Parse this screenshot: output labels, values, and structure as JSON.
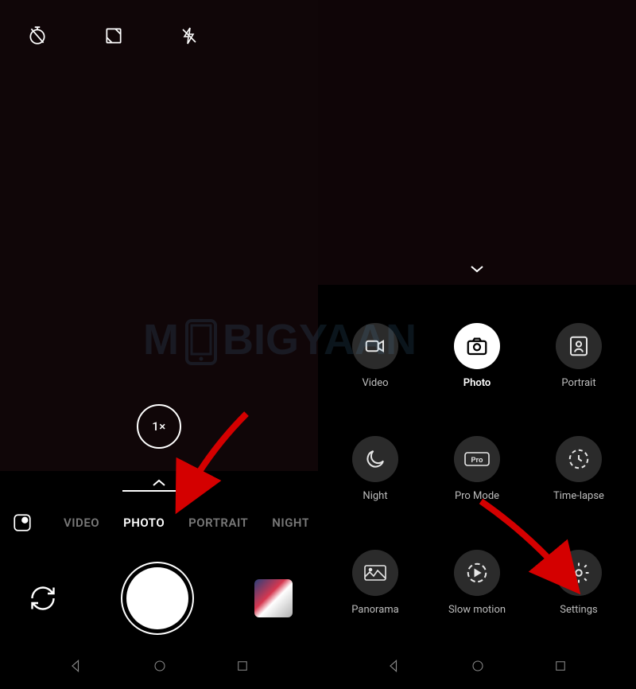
{
  "left": {
    "zoom_label": "1×",
    "modes": [
      "VIDEO",
      "PHOTO",
      "PORTRAIT",
      "NIGHT"
    ],
    "active_mode_index": 1
  },
  "right": {
    "tiles": [
      {
        "label": "Video",
        "icon": "videocam",
        "active": false
      },
      {
        "label": "Photo",
        "icon": "camera",
        "active": true
      },
      {
        "label": "Portrait",
        "icon": "portrait",
        "active": false
      },
      {
        "label": "Night",
        "icon": "moon",
        "active": false
      },
      {
        "label": "Pro Mode",
        "icon": "pro",
        "active": false
      },
      {
        "label": "Time-lapse",
        "icon": "timelapse",
        "active": false
      },
      {
        "label": "Panorama",
        "icon": "panorama",
        "active": false
      },
      {
        "label": "Slow motion",
        "icon": "slowmo",
        "active": false
      },
      {
        "label": "Settings",
        "icon": "gear",
        "active": false
      }
    ]
  },
  "watermark_text": "MOBIGYAAN"
}
